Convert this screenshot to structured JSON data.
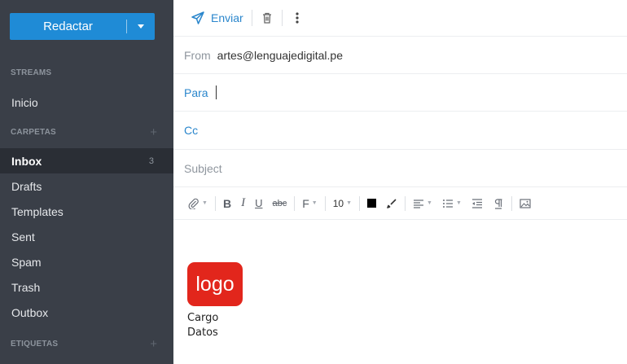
{
  "sidebar": {
    "compose_label": "Redactar",
    "sections": {
      "streams": "STREAMS",
      "folders": "CARPETAS",
      "tags": "ETIQUETAS"
    },
    "streams_items": [
      {
        "label": "Inicio"
      }
    ],
    "folder_items": [
      {
        "label": "Inbox",
        "count": "3",
        "active": true
      },
      {
        "label": "Drafts"
      },
      {
        "label": "Templates"
      },
      {
        "label": "Sent"
      },
      {
        "label": "Spam"
      },
      {
        "label": "Trash"
      },
      {
        "label": "Outbox"
      }
    ],
    "plus_glyph": "+"
  },
  "toolbar": {
    "send_label": "Enviar"
  },
  "compose": {
    "from_label": "From",
    "from_value": "artes@lenguajedigital.pe",
    "to_label": "Para",
    "cc_label": "Cc",
    "subject_placeholder": "Subject"
  },
  "format": {
    "bold": "B",
    "italic": "I",
    "underline": "U",
    "strike": "abc",
    "font": "F",
    "size": "10",
    "text_color": "#000000"
  },
  "signature": {
    "logo_text": "logo",
    "line1": "Cargo",
    "line2": "Datos"
  },
  "colors": {
    "accent": "#1f8bd6",
    "sidebar_bg": "#3a3f48",
    "logo_bg": "#e2261c"
  }
}
